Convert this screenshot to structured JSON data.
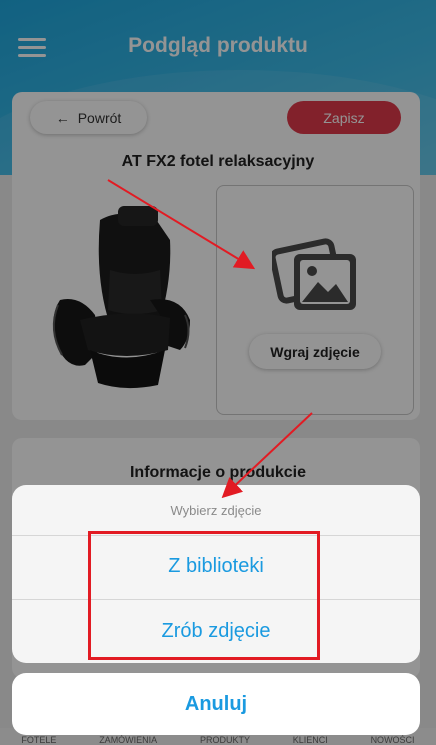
{
  "header": {
    "title": "Podgląd produktu"
  },
  "actions": {
    "back_label": "Powrót",
    "back_arrow": "←",
    "save_label": "Zapisz"
  },
  "product": {
    "name": "AT FX2 fotel relaksacyjny",
    "upload_label": "Wgraj zdjęcie"
  },
  "info": {
    "title": "Informacje o produkcie"
  },
  "sheet": {
    "title": "Wybierz zdjęcie",
    "options": [
      "Z biblioteki",
      "Zrób zdjęcie"
    ],
    "cancel_label": "Anuluj"
  },
  "bottom_nav": [
    "FOTELE",
    "ZAMÓWIENIA",
    "PRODUKTY",
    "KLIENCI",
    "NOWOŚCI"
  ],
  "colors": {
    "accent_blue": "#1a9ae0",
    "save_red": "#e03a4a",
    "annotation_red": "#e21b23"
  }
}
